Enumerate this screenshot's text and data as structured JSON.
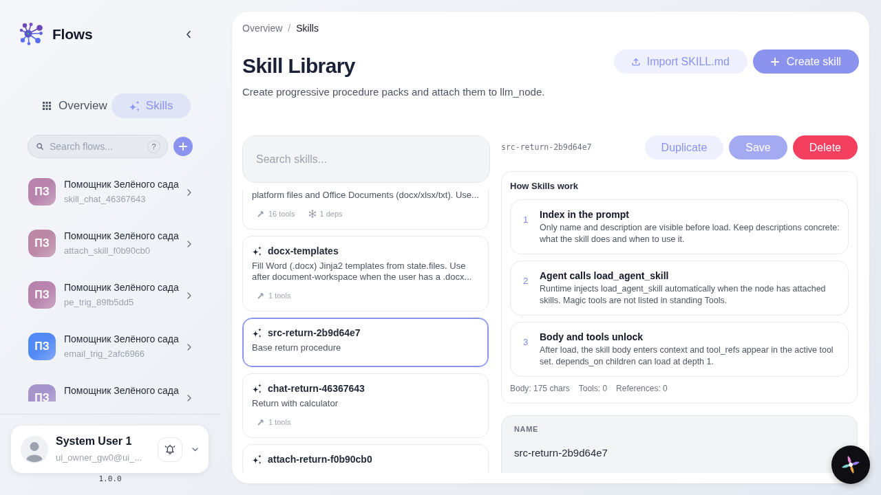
{
  "sidebar": {
    "brand": {
      "title": "Flows"
    },
    "nav": [
      {
        "label": "Overview",
        "kind": "overview",
        "selected": false
      },
      {
        "label": "Skills",
        "kind": "skills",
        "selected": true
      }
    ],
    "search": {
      "placeholder": "Search flows...",
      "help": "?"
    },
    "flows": [
      {
        "initials": "ПЗ",
        "title": "Помощник Зелёного сада",
        "subtitle": "skill_chat_46367643",
        "color": "#b884ad"
      },
      {
        "initials": "ПЗ",
        "title": "Помощник Зелёного сада",
        "subtitle": "attach_skill_f0b90cb0",
        "color": "#bb88a6"
      },
      {
        "initials": "ПЗ",
        "title": "Помощник Зелёного сада",
        "subtitle": "pe_trig_89fb5dd5",
        "color": "#b884ad"
      },
      {
        "initials": "ПЗ",
        "title": "Помощник Зелёного сада",
        "subtitle": "email_trig_2afc6966",
        "color": "#5289f5"
      },
      {
        "initials": "ПЗ",
        "title": "Помощник Зелёного сада",
        "color": "#a694cd"
      }
    ],
    "user": {
      "name": "System User 1",
      "email": "ui_owner_gw0@ui_..."
    },
    "version": "1.0.0"
  },
  "main": {
    "breadcrumb": {
      "items": [
        "Overview",
        "Skills"
      ],
      "separator": "/"
    },
    "header": {
      "title": "Skill Library",
      "subtitle": "Create progressive procedure packs and attach them to llm_node.",
      "actions": [
        {
          "label": "Import SKILL.md",
          "kind": "import"
        },
        {
          "label": "Create skill",
          "kind": "create"
        }
      ]
    },
    "skill_list": {
      "search": {
        "placeholder": "Search skills..."
      },
      "skills": [
        {
          "description": "platform files and Office Documents (docx/xlsx/txt). Use...",
          "tools": "16 tools",
          "deps": "1 deps",
          "selected": false
        },
        {
          "name": "docx-templates",
          "description": "Fill Word (.docx) Jinja2 templates from state.files. Use after document-workspace when the user has a .docx...",
          "tools": "1 tools",
          "selected": false
        },
        {
          "name": "src-return-2b9d64e7",
          "description": "Base return procedure",
          "selected": true
        },
        {
          "name": "chat-return-46367643",
          "description": "Return with calculator",
          "tools": "1 tools",
          "selected": false
        },
        {
          "name": "attach-return-f0b90cb0",
          "selected": false
        }
      ]
    },
    "detail": {
      "slug": "src-return-2b9d64e7",
      "actions": [
        {
          "label": "Duplicate",
          "kind": "secondary",
          "disabled": false
        },
        {
          "label": "Save",
          "kind": "primary",
          "disabled": true
        },
        {
          "label": "Delete",
          "kind": "danger",
          "disabled": false
        }
      ],
      "how_it_works": {
        "title": "How Skills work",
        "steps": [
          {
            "number": "1",
            "title": "Index in the prompt",
            "text": "Only name and description are visible before load. Keep descriptions concrete: what the skill does and when to use it."
          },
          {
            "number": "2",
            "title": "Agent calls load_agent_skill",
            "text": "Runtime injects load_agent_skill automatically when the node has attached skills. Magic tools are not listed in standing Tools."
          },
          {
            "number": "3",
            "title": "Body and tools unlock",
            "text": "After load, the skill body enters context and tool_refs appear in the active tool set. depends_on children can load at depth 1."
          }
        ],
        "stats": [
          "Body: 175 chars",
          "Tools: 0",
          "References: 0"
        ]
      },
      "name_field": {
        "label": "NAME",
        "value": "src-return-2b9d64e7"
      }
    }
  }
}
